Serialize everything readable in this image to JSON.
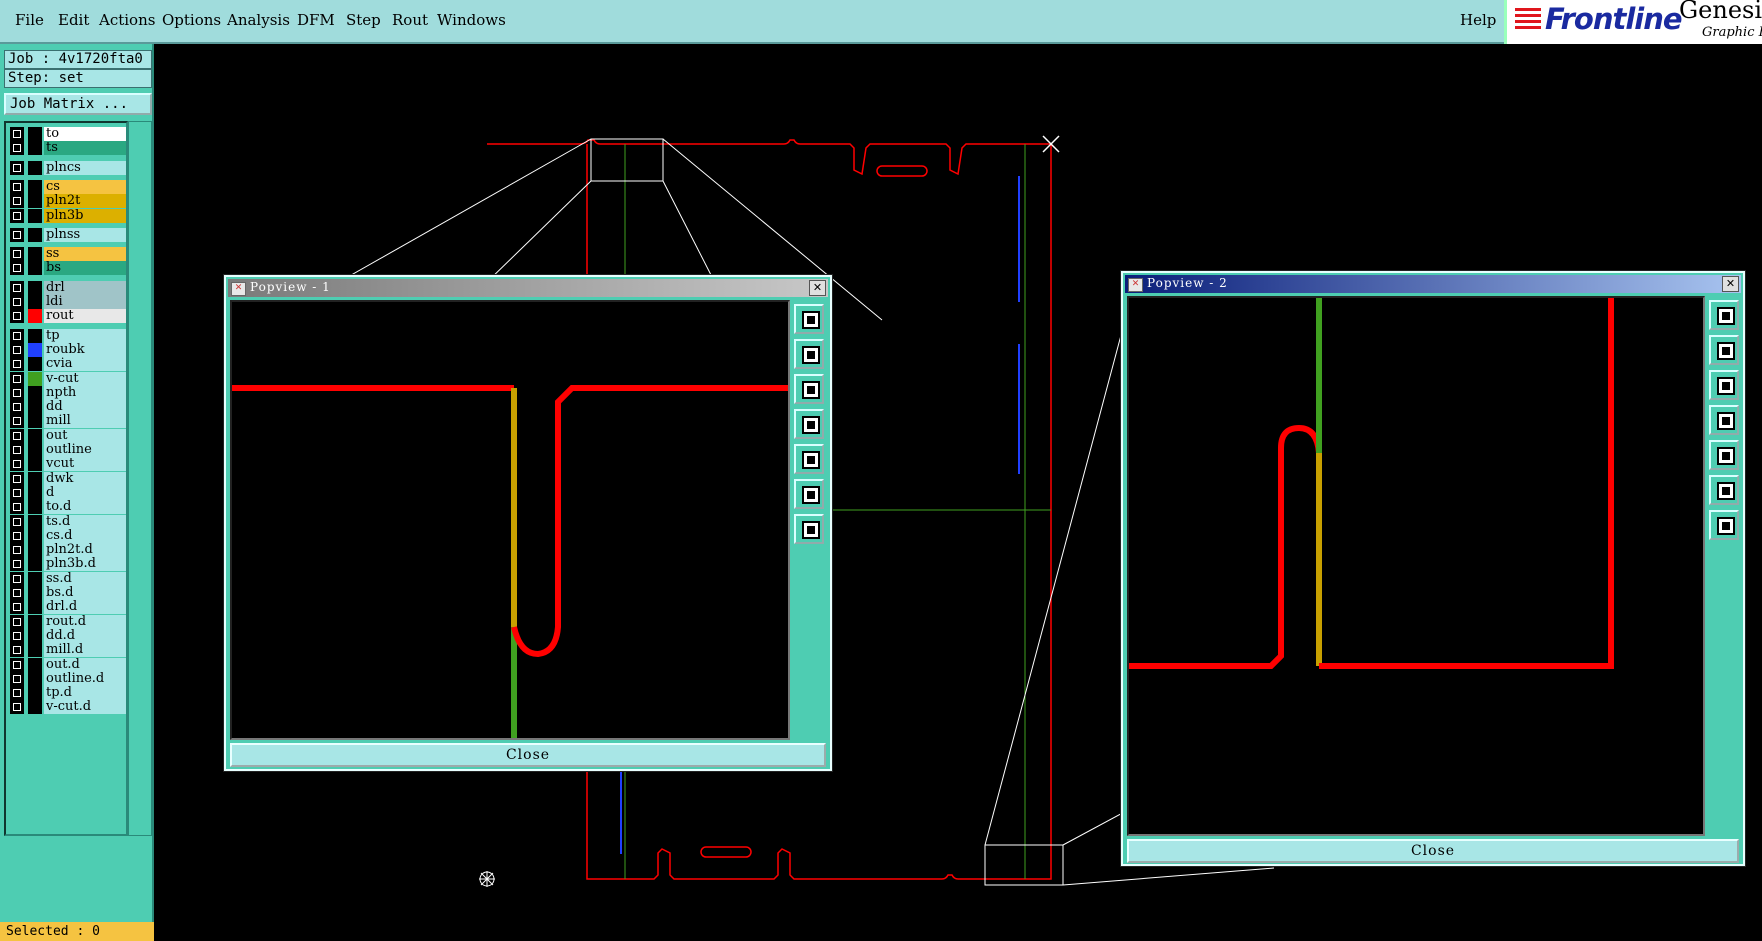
{
  "menu": {
    "file": "File",
    "edit": "Edit",
    "actions": "Actions",
    "options": "Options",
    "analysis": "Analysis",
    "dfm": "DFM",
    "step": "Step",
    "rout": "Rout",
    "windows": "Windows",
    "help": "Help"
  },
  "brand": {
    "logo": "Frontline",
    "product": "Genesis",
    "subtitle": "Graphic E"
  },
  "job": {
    "label": "Job : 4v1720fta0",
    "step": "Step: set",
    "matrix_button": "Job Matrix ..."
  },
  "layers": [
    {
      "name": "to",
      "color": "#ffffff",
      "swatch": "#000000"
    },
    {
      "name": "ts",
      "color": "#2aa882",
      "swatch": "#000000"
    },
    {
      "name": "plncs",
      "color": "#a8e6e6",
      "swatch": "#000000"
    },
    {
      "name": "cs",
      "color": "#f5c341",
      "swatch": "#000000"
    },
    {
      "name": "pln2t",
      "color": "#dcb000",
      "swatch": "#000000"
    },
    {
      "name": "pln3b",
      "color": "#dcb000",
      "swatch": "#000000"
    },
    {
      "name": "plnss",
      "color": "#a8e6e6",
      "swatch": "#000000"
    },
    {
      "name": "ss",
      "color": "#f5c341",
      "swatch": "#000000"
    },
    {
      "name": "bs",
      "color": "#2aa882",
      "swatch": "#000000"
    },
    {
      "name": "drl",
      "color": "#a0c4c8",
      "swatch": "#000000"
    },
    {
      "name": "ldi",
      "color": "#a0c4c8",
      "swatch": "#000000"
    },
    {
      "name": "rout",
      "color": "#e8e8e8",
      "swatch": "#ff0000"
    },
    {
      "name": "tp",
      "color": "#a8e6e6",
      "swatch": "#000000"
    },
    {
      "name": "roubk",
      "color": "#a8e6e6",
      "swatch": "#2040ff"
    },
    {
      "name": "cvia",
      "color": "#a8e6e6",
      "swatch": "#000000"
    },
    {
      "name": "v-cut",
      "color": "#a8e6e6",
      "swatch": "#40a020"
    },
    {
      "name": "npth",
      "color": "#a8e6e6",
      "swatch": "#000000"
    },
    {
      "name": "dd",
      "color": "#a8e6e6",
      "swatch": "#000000"
    },
    {
      "name": "mill",
      "color": "#a8e6e6",
      "swatch": "#000000"
    },
    {
      "name": "out",
      "color": "#a8e6e6",
      "swatch": "#000000"
    },
    {
      "name": "outline",
      "color": "#a8e6e6",
      "swatch": "#000000"
    },
    {
      "name": "vcut",
      "color": "#a8e6e6",
      "swatch": "#000000"
    },
    {
      "name": "dwk",
      "color": "#a8e6e6",
      "swatch": "#000000"
    },
    {
      "name": "d",
      "color": "#a8e6e6",
      "swatch": "#000000"
    },
    {
      "name": "to.d",
      "color": "#a8e6e6",
      "swatch": "#000000"
    },
    {
      "name": "ts.d",
      "color": "#a8e6e6",
      "swatch": "#000000"
    },
    {
      "name": "cs.d",
      "color": "#a8e6e6",
      "swatch": "#000000"
    },
    {
      "name": "pln2t.d",
      "color": "#a8e6e6",
      "swatch": "#000000"
    },
    {
      "name": "pln3b.d",
      "color": "#a8e6e6",
      "swatch": "#000000"
    },
    {
      "name": "ss.d",
      "color": "#a8e6e6",
      "swatch": "#000000"
    },
    {
      "name": "bs.d",
      "color": "#a8e6e6",
      "swatch": "#000000"
    },
    {
      "name": "drl.d",
      "color": "#a8e6e6",
      "swatch": "#000000"
    },
    {
      "name": "rout.d",
      "color": "#a8e6e6",
      "swatch": "#000000"
    },
    {
      "name": "dd.d",
      "color": "#a8e6e6",
      "swatch": "#000000"
    },
    {
      "name": "mill.d",
      "color": "#a8e6e6",
      "swatch": "#000000"
    },
    {
      "name": "out.d",
      "color": "#a8e6e6",
      "swatch": "#000000"
    },
    {
      "name": "outline.d",
      "color": "#a8e6e6",
      "swatch": "#000000"
    },
    {
      "name": "tp.d",
      "color": "#a8e6e6",
      "swatch": "#000000"
    },
    {
      "name": "v-cut.d",
      "color": "#a8e6e6",
      "swatch": "#000000"
    }
  ],
  "status": {
    "selected": "Selected : 0"
  },
  "popview1": {
    "title": "Popview - 1",
    "close": "Close"
  },
  "popview2": {
    "title": "Popview - 2",
    "close": "Close"
  },
  "tool_icons": [
    "zoom-home-icon",
    "pan-up-icon",
    "pan-down-icon",
    "pan-left-icon",
    "pan-right-icon",
    "zoom-fit-icon",
    "zoom-center-icon"
  ],
  "colors": {
    "rout": "#ff0000",
    "vcut": "#40a020",
    "roubk": "#2040ff",
    "panel": "#4ecdb2",
    "menubar": "#a0dcdc"
  }
}
